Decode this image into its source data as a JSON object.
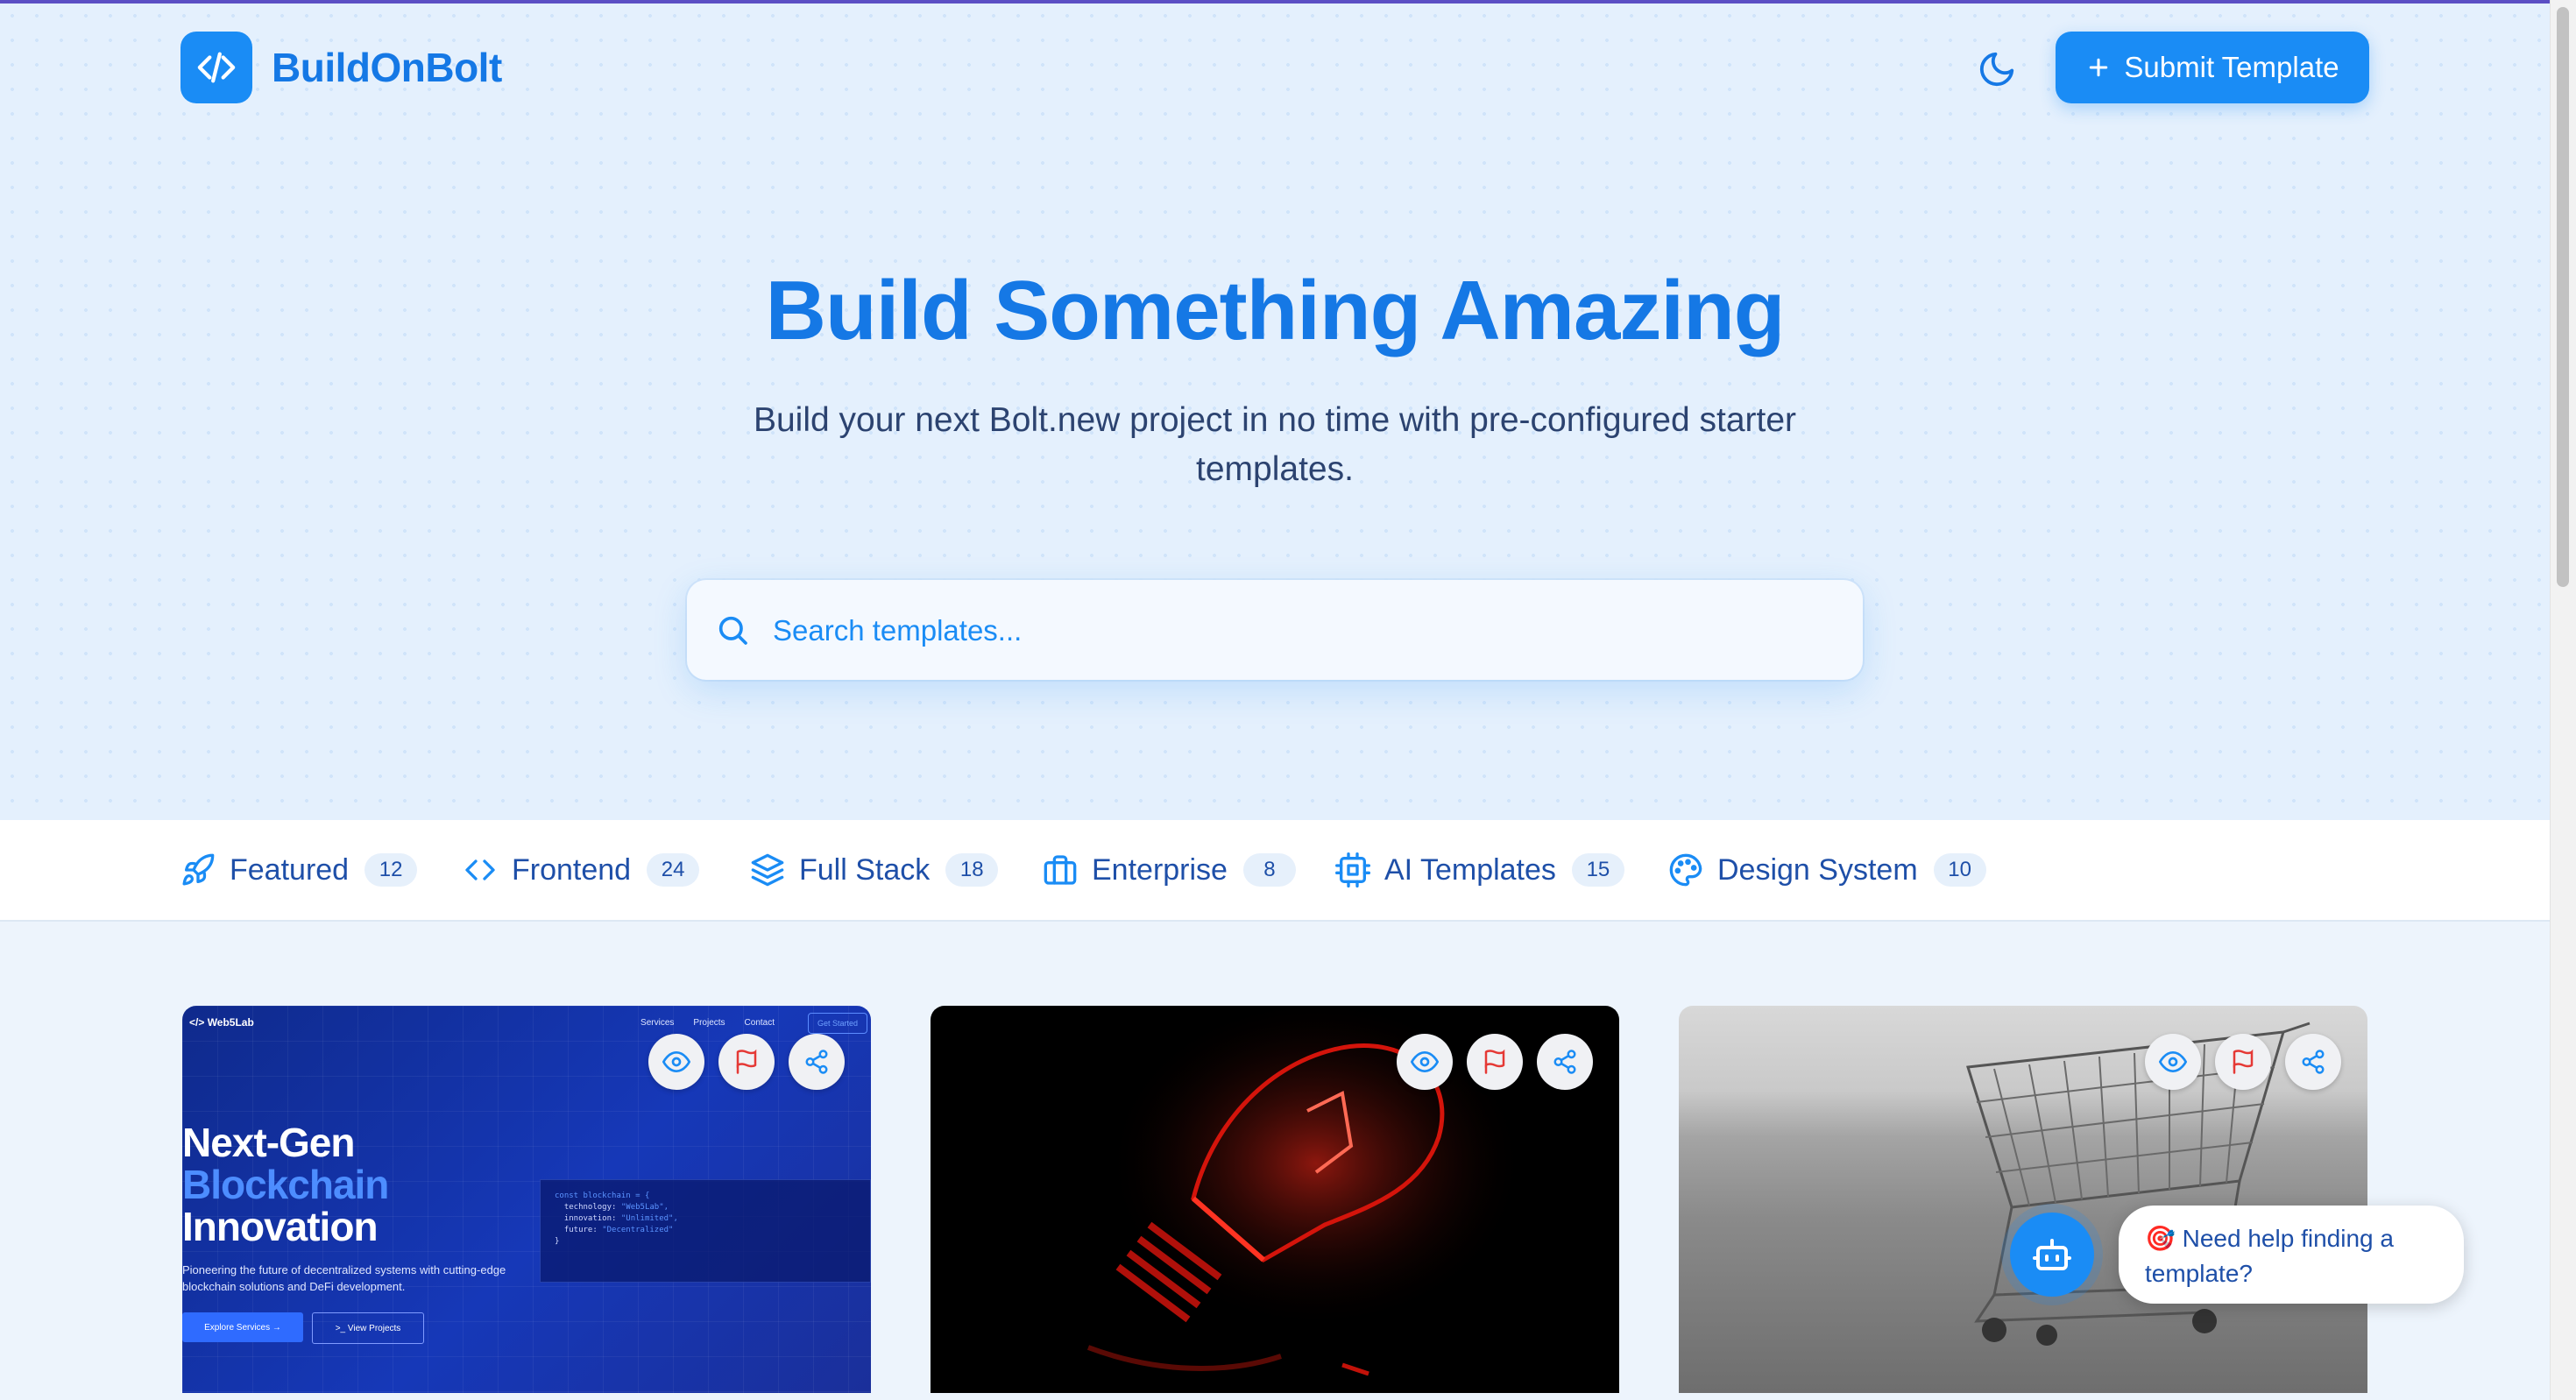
{
  "header": {
    "brand": "BuildOnBolt",
    "logo_icon": "code-icon",
    "theme_toggle_icon": "moon-icon",
    "submit_label": "Submit Template"
  },
  "hero": {
    "title": "Build Something Amazing",
    "subtitle": "Build your next Bolt.new project in no time with pre-configured starter templates."
  },
  "search": {
    "placeholder": "Search templates..."
  },
  "categories": [
    {
      "label": "Featured",
      "count": "12",
      "icon": "rocket-icon"
    },
    {
      "label": "Frontend",
      "count": "24",
      "icon": "code-icon"
    },
    {
      "label": "Full Stack",
      "count": "18",
      "icon": "layers-icon"
    },
    {
      "label": "Enterprise",
      "count": "8",
      "icon": "briefcase-icon"
    },
    {
      "label": "AI Templates",
      "count": "15",
      "icon": "cpu-icon"
    },
    {
      "label": "Design System",
      "count": "10",
      "icon": "palette-icon"
    }
  ],
  "cards": [
    {
      "preview": {
        "logo": "Web5Lab",
        "nav": [
          "Services",
          "Projects",
          "Contact"
        ],
        "cta": "Get Started",
        "headline_1": "Next-Gen",
        "headline_2": "Blockchain",
        "headline_3": "Innovation",
        "description": "Pioneering the future of decentralized systems with cutting-edge blockchain solutions and DeFi development.",
        "button_1": "Explore Services →",
        "button_2": ">_ View Projects",
        "code_line_1": "const blockchain = {",
        "code_line_2_key": "  technology: ",
        "code_line_2_val": "\"Web5Lab\",",
        "code_line_3_key": "  innovation: ",
        "code_line_3_val": "\"Unlimited\",",
        "code_line_4_key": "  future: ",
        "code_line_4_val": "\"Decentralized\"",
        "code_line_5": "}"
      }
    },
    {
      "preview_subject": "red glowing light bulb"
    },
    {
      "preview_subject": "shopping cart"
    }
  ],
  "chat": {
    "prompt": "🎯 Need help finding a template?",
    "icon": "robot-icon"
  },
  "colors": {
    "accent": "#1a8cf5",
    "brand_text": "#1578e5",
    "flag": "#e53935"
  }
}
